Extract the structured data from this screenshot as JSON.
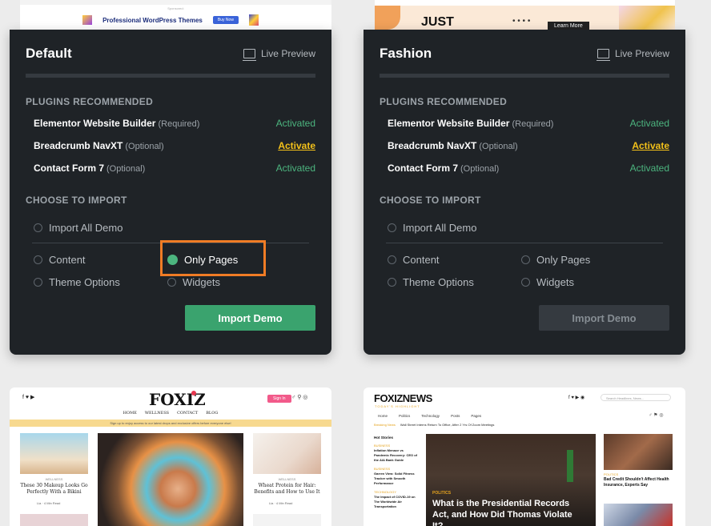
{
  "card_default": {
    "title": "Default",
    "live_preview": "Live Preview",
    "thumb_caption": "Sponsored:",
    "thumb_ad": "Professional WordPress Themes",
    "thumb_ad_btn": "Buy Now",
    "plugins_heading": "PLUGINS RECOMMENDED",
    "plugins": [
      {
        "name": "Elementor Website Builder",
        "note": "(Required)",
        "status": "Activated"
      },
      {
        "name": "Breadcrumb NavXT",
        "note": "(Optional)",
        "status": "Activate"
      },
      {
        "name": "Contact Form 7",
        "note": "(Optional)",
        "status": "Activated"
      }
    ],
    "import_heading": "CHOOSE TO IMPORT",
    "options": {
      "all": "Import All Demo",
      "content": "Content",
      "only_pages": "Only Pages",
      "theme_options": "Theme Options",
      "widgets": "Widgets"
    },
    "import_button": "Import Demo"
  },
  "card_fashion": {
    "title": "Fashion",
    "live_preview": "Live Preview",
    "thumb_ad": "JUST",
    "thumb_ad_btn": "Learn More",
    "plugins_heading": "PLUGINS RECOMMENDED",
    "plugins": [
      {
        "name": "Elementor Website Builder",
        "note": "(Required)",
        "status": "Activated"
      },
      {
        "name": "Breadcrumb NavXT",
        "note": "(Optional)",
        "status": "Activate"
      },
      {
        "name": "Contact Form 7",
        "note": "(Optional)",
        "status": "Activated"
      }
    ],
    "import_heading": "CHOOSE TO IMPORT",
    "options": {
      "all": "Import All Demo",
      "content": "Content",
      "only_pages": "Only Pages",
      "theme_options": "Theme Options",
      "widgets": "Widgets"
    },
    "import_button": "Import Demo"
  },
  "thumb_foxiz": {
    "logo": "FOXIZ",
    "nav": [
      "HOME",
      "WELLNESS",
      "CONTACT",
      "BLOG"
    ],
    "sign_in": "Sign In",
    "banner": "Sign up to enjoy access to our latest drops and exclusive offers before everyone else!",
    "left_cat": "WELLNESS",
    "left_headline": "These 30 Makeup Looks Go Perfectly With a Bikini",
    "right_cat": "WELLNESS",
    "right_headline": "Wheat Protein for Hair: Benefits and How to Use It",
    "author": "Lia",
    "readtime": "4 Min Read"
  },
  "thumb_news": {
    "logo": "FOXIZNEWS",
    "tagline": "TODAY'S HIGHLIGHT",
    "search_placeholder": "Search Headlines, News...",
    "nav": [
      "Home",
      "Politics",
      "Technology",
      "Posts",
      "Pages"
    ],
    "breaking_label": "Breaking News",
    "breaking_text": "Wall Street Interns Return To Office, After 2 Yrs Of Zoom Meetings",
    "top_stories": "Hot Stories",
    "left_items": [
      {
        "cat": "BUSINESS",
        "title": "Inflation Menace vs Pandemic Recovery: CEO of the AIA Bank Guide"
      },
      {
        "cat": "BUSINESS",
        "title": "Garren View: Solid Fitness Tracker with Smooth Performance"
      },
      {
        "cat": "TECHNOLOGY",
        "title": "The Impact of COVID-19 on The Worldwide Air Transportation"
      }
    ],
    "main_cat": "POLITICS",
    "main_headline": "What is the Presidential Records Act, and How Did Thomas Violate It?",
    "right_cat": "POLITICS",
    "right_headline": "Bad Credit Shouldn't Affect Health Insurance, Experts Say"
  },
  "colors": {
    "card_bg": "#1f2327",
    "activated": "#4cb57f",
    "activate_link": "#f3c11a",
    "import_green": "#3aa36e",
    "highlight": "#f07c25",
    "page_bg": "#ececec"
  }
}
